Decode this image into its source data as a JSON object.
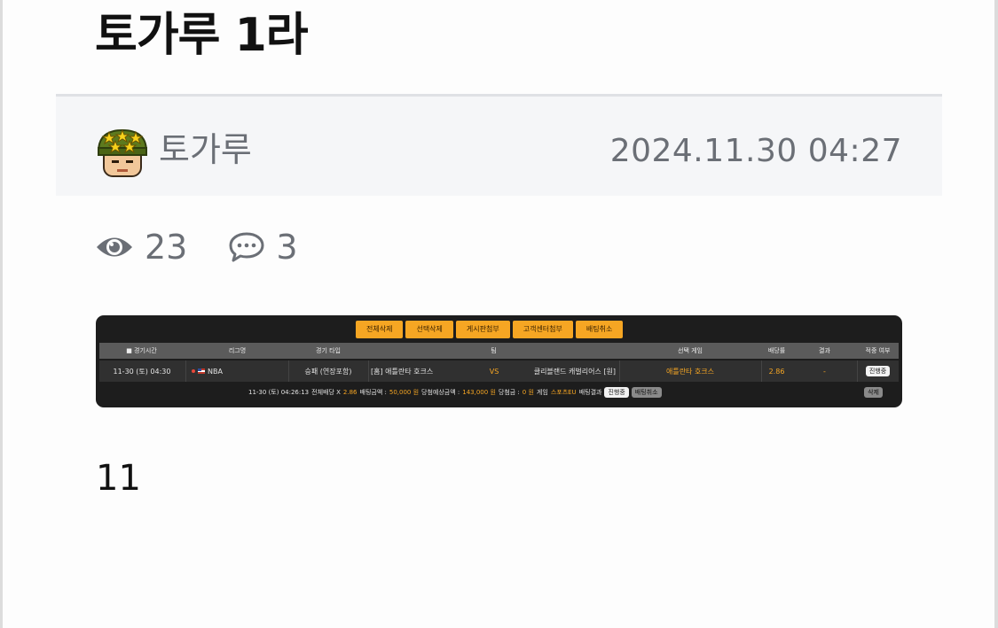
{
  "post": {
    "title": "토가루 1라",
    "author": "토가루",
    "date": "2024.11.30 04:27",
    "views": "23",
    "comments": "3",
    "body": "11"
  },
  "icons": {
    "avatar": "soldier-avatar-icon",
    "views": "eye-icon",
    "comments": "speech-bubble-icon"
  },
  "bet_slip": {
    "buttons": [
      "전체삭제",
      "선택삭제",
      "게시판첨부",
      "고객센터첨부",
      "배팅취소"
    ],
    "headers": [
      "■ 경기시간",
      "리그명",
      "경기 타입",
      "팀",
      "선택 게임",
      "배당률",
      "결과",
      "적중 여부"
    ],
    "row": {
      "time": "11-30 (토) 04:30",
      "league": "NBA",
      "type": "승패 (연장포함)",
      "home": "[홈] 애틀란타 호크스",
      "vs": "VS",
      "away": "클리블랜드 캐벌리어스 [원]",
      "pick": "애틀란타 호크스",
      "odds": "2.86",
      "result": "-",
      "status": "진행중"
    },
    "summary": {
      "datetime": "11-30 (토) 04:26:13",
      "total_odds_label": "전체배당 X",
      "total_odds": "2.86",
      "bet_label": "배팅금액 :",
      "bet_amount": "50,000 원",
      "expected_label": "당첨예상금액 :",
      "expected_amount": "143,000 원",
      "won_label": "당첨금 :",
      "won_amount": "0 원",
      "game_label": "게임",
      "game_value": "스포츠EU",
      "result_label": "배팅결과",
      "result_status": "진행중",
      "cancel_label": "배팅취소",
      "delete_label": "삭제"
    }
  },
  "colors": {
    "accent_orange": "#f6a623",
    "meta_text": "#6b6f76",
    "card_bg": "#1d1d1d"
  }
}
